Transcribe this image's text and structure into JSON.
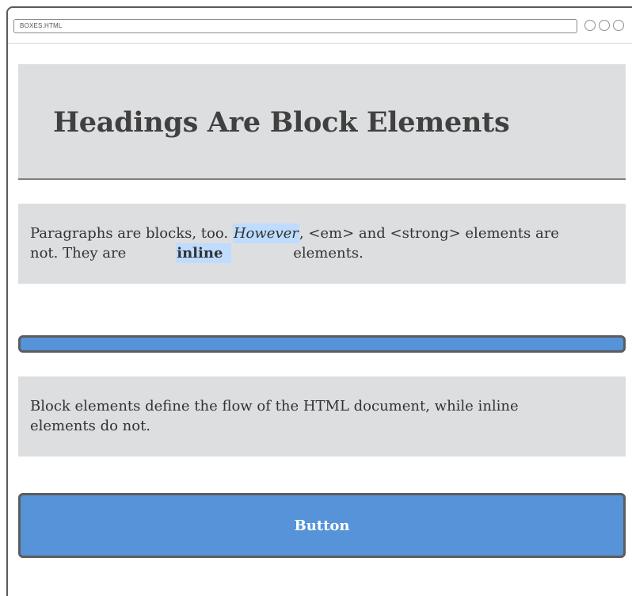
{
  "window": {
    "address_text": "BOXES.HTML"
  },
  "heading": {
    "text": "Headings Are Block Elements"
  },
  "paragraph_1": {
    "segment_1": "Paragraphs are blocks, too. ",
    "em": "However",
    "segment_2": ", <em> and <strong> elements are",
    "segment_3": "not. They are",
    "strong": "inline",
    "segment_4": "elements."
  },
  "paragraph_2": {
    "line_1": "Block elements define the flow of the HTML document, while inline",
    "line_2": "elements do not."
  },
  "button": {
    "label": "Button"
  },
  "colors": {
    "panel_gray": "#dcdee0",
    "highlight_blue": "#bfdcff",
    "button_blue": "#5693d8",
    "border_gray": "#5d5d5d"
  }
}
